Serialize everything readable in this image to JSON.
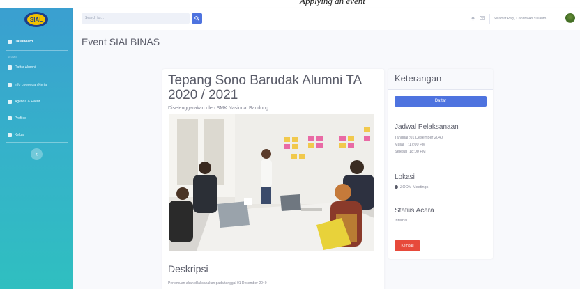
{
  "caption": "Applying an event",
  "sidebar": {
    "logo_text": "SIAL",
    "section_label": "ALUMNI",
    "items": [
      {
        "label": "Dashboard"
      },
      {
        "label": "Daftar Alumni"
      },
      {
        "label": "Info Lowongan Kerja"
      },
      {
        "label": "Agenda & Event"
      },
      {
        "label": "Profiles"
      },
      {
        "label": "Keluar"
      }
    ],
    "collapse_glyph": "‹"
  },
  "topbar": {
    "search_placeholder": "Search for...",
    "search_icon": "search-icon",
    "alerts_icon": "bell-icon",
    "messages_icon": "envelope-icon",
    "greeting": "Selamat Pagi, Candra Ari Yulianto"
  },
  "page": {
    "title": "Event SIALBINAS"
  },
  "event": {
    "title": "Tepang Sono Barudak Alumni TA 2020 / 2021",
    "organizer": "Diselenggarakan oleh SMK Nasional Bandung",
    "description_heading": "Deskripsi",
    "description_text": "Pertemuan akan dilaksanakan pada tanggal 01 Desember 2040"
  },
  "side": {
    "heading": "Keterangan",
    "register_label": "Daftar",
    "schedule_heading": "Jadwal Pelaksanaan",
    "schedule_date": "Tanggal :01 Desember 2040",
    "schedule_start": "Mulai    :17:00 PM",
    "schedule_end": "Selesai :18:00 PM",
    "location_heading": "Lokasi",
    "location_value": "ZOOM Meetings",
    "status_heading": "Status Acara",
    "status_value": "Internal",
    "back_label": "Kembali"
  },
  "colors": {
    "primary": "#4e73df",
    "danger": "#e74a3b",
    "sidebar_top": "#3a9fd0",
    "sidebar_bottom": "#2fbfc0"
  }
}
